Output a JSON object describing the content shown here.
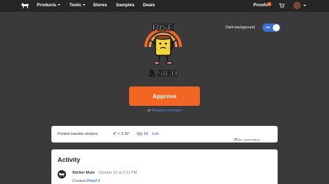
{
  "nav": {
    "items": [
      {
        "label": "Products",
        "has_caret": true
      },
      {
        "label": "Tools",
        "has_caret": true
      },
      {
        "label": "Stores",
        "has_caret": false
      },
      {
        "label": "Samples",
        "has_caret": false
      },
      {
        "label": "Deals",
        "has_caret": false
      }
    ],
    "proofs_label": "Proofs",
    "proofs_count": "1",
    "icons": {
      "logo": "mule-logo-icon",
      "cart": "cart-icon",
      "avatar": "user-avatar"
    }
  },
  "dark_background": {
    "label": "Dark background",
    "state": "ON"
  },
  "sticker": {
    "line1": "RISE",
    "line2": "& SIGH"
  },
  "approve": {
    "label": "Approve",
    "or": "or",
    "request_changes": "Request changes"
  },
  "summary": {
    "product": "Printed transfer stickers",
    "size": "4\" × 3.16\"",
    "qty": "Qty 10",
    "edit": "Edit",
    "order_summary": "Order summary"
  },
  "activity": {
    "title": "Activity",
    "entry": {
      "author": "Sticker Mule",
      "time": "October 22 at 1:21 PM",
      "created": "Created",
      "proof": "Proof 1"
    }
  },
  "colors": {
    "accent": "#f26522",
    "link": "#4f8fe6",
    "toggle": "#3a73c7",
    "bg": "#3a3a3a",
    "nav": "#262626"
  }
}
